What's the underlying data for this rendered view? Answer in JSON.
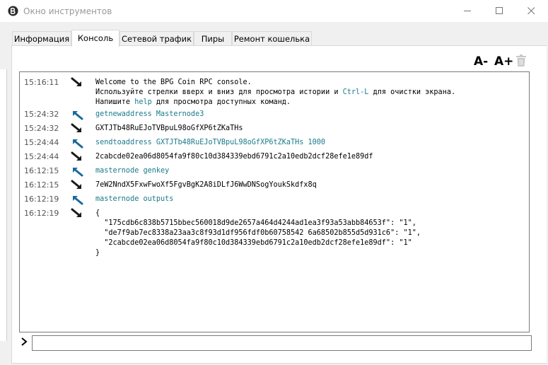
{
  "window": {
    "title": "Окно инструментов",
    "accent": "#1a7a8a"
  },
  "tabs": [
    {
      "label": "Информация",
      "active": false
    },
    {
      "label": "Консоль",
      "active": true
    },
    {
      "label": "Сетевой трафик",
      "active": false
    },
    {
      "label": "Пиры",
      "active": false
    },
    {
      "label": "Ремонт кошелька",
      "active": false
    }
  ],
  "toolbar": {
    "font_smaller": "A-",
    "font_larger": "A+",
    "clear_icon": "trash-icon"
  },
  "console": {
    "entries": [
      {
        "time": "15:16:11",
        "direction": "reply",
        "lines": [
          "Welcome to the BPG Coin RPC console.",
          "Используйте стрелки вверх и вниз для просмотра истории и Ctrl-L для очистки экрана.",
          "Напишите help для просмотра доступных команд."
        ]
      },
      {
        "time": "15:24:32",
        "direction": "command",
        "text": "getnewaddress Masternode3"
      },
      {
        "time": "15:24:32",
        "direction": "reply",
        "text": "GXTJTb48RuEJoTVBpuL98oGfXP6tZKaTHs"
      },
      {
        "time": "15:24:44",
        "direction": "command",
        "text": "sendtoaddress GXTJTb48RuEJoTVBpuL98oGfXP6tZKaTHs 1000"
      },
      {
        "time": "15:24:44",
        "direction": "reply",
        "text": "2cabcde02ea06d8054fa9f80c10d384339ebd6791c2a10edb2dcf28efe1e89df"
      },
      {
        "time": "16:12:15",
        "direction": "command",
        "text": "masternode genkey"
      },
      {
        "time": "16:12:15",
        "direction": "reply",
        "text": "7eW2NndX5FxwFwoXf5FgvBgK2A8iDLfJ6WwDNSogYoukSkdfx8q"
      },
      {
        "time": "16:12:19",
        "direction": "command",
        "text": "masternode outputs"
      },
      {
        "time": "16:12:19",
        "direction": "reply",
        "lines": [
          "{",
          "  \"175cdb6c838b5715bbec560018d9de2657a464d4244ad1ea3f93a53abb84653f\": \"1\",",
          "  \"de7f9ab7ec8338a23aa3c8f93d1df956fdf0b60758542 6a68502b855d5d931c6\": \"1\",",
          "  \"2cabcde02ea06d8054fa9f80c10d384339ebd6791c2a10edb2dcf28efe1e89df\": \"1\"",
          "}"
        ]
      }
    ]
  },
  "input": {
    "value": "",
    "prompt_icon": "chevron-right-icon"
  }
}
